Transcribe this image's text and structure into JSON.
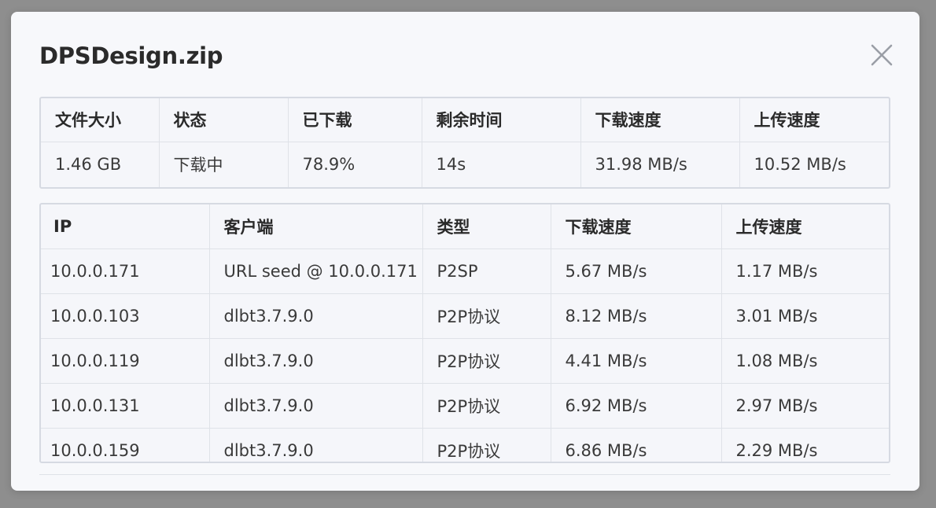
{
  "dialog": {
    "title": "DPSDesign.zip"
  },
  "summary": {
    "headers": [
      "文件大小",
      "状态",
      "已下载",
      "剩余时间",
      "下载速度",
      "上传速度"
    ],
    "values": [
      "1.46 GB",
      "下载中",
      "78.9%",
      "14s",
      "31.98 MB/s",
      "10.52 MB/s"
    ]
  },
  "peers": {
    "headers": [
      "IP",
      "客户端",
      "类型",
      "下载速度",
      "上传速度"
    ],
    "rows": [
      [
        "10.0.0.171",
        "URL seed @ 10.0.0.171",
        "P2SP",
        "5.67 MB/s",
        "1.17 MB/s"
      ],
      [
        "10.0.0.103",
        "dlbt3.7.9.0",
        "P2P协议",
        "8.12 MB/s",
        "3.01 MB/s"
      ],
      [
        "10.0.0.119",
        "dlbt3.7.9.0",
        "P2P协议",
        "4.41 MB/s",
        "1.08 MB/s"
      ],
      [
        "10.0.0.131",
        "dlbt3.7.9.0",
        "P2P协议",
        "6.92 MB/s",
        "2.97 MB/s"
      ],
      [
        "10.0.0.159",
        "dlbt3.7.9.0",
        "P2P协议",
        "6.86 MB/s",
        "2.29 MB/s"
      ]
    ]
  },
  "icons": {
    "close": "close-icon"
  },
  "colors": {
    "backdrop": "#8f8f8f",
    "dialog_background": "#f7f8fb",
    "table_border": "#d6dae2",
    "text": "#333333"
  }
}
